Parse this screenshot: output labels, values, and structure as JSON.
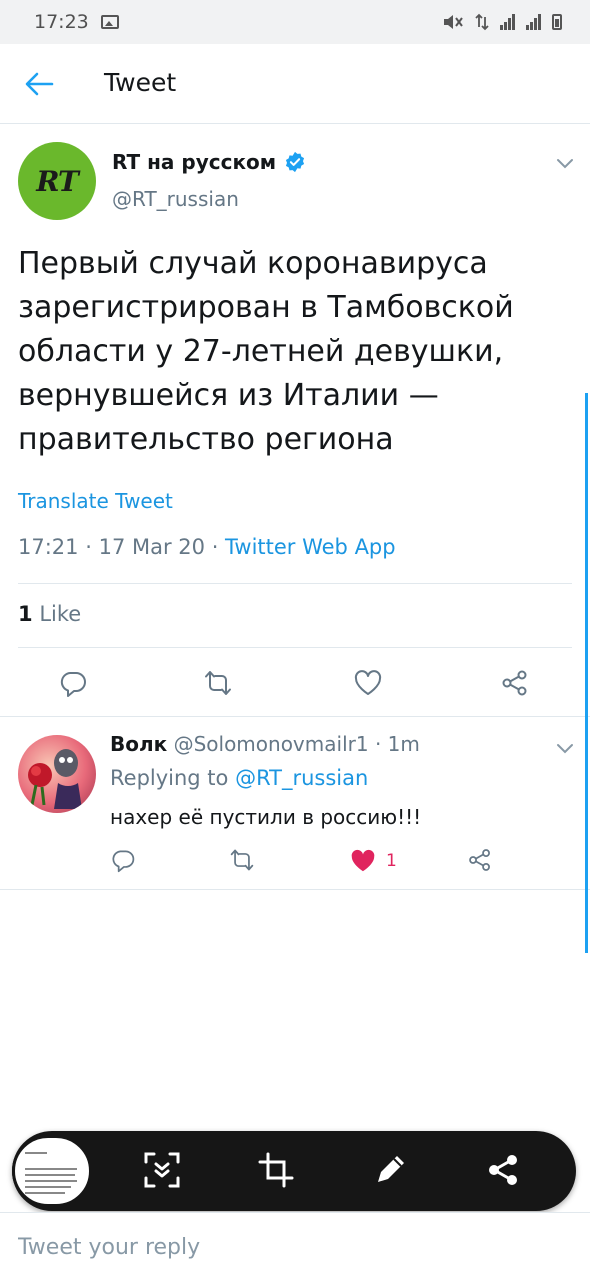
{
  "status_bar": {
    "time": "17:23"
  },
  "header": {
    "title": "Tweet"
  },
  "tweet": {
    "avatar_text": "RT",
    "author_name": "RT на русском",
    "author_handle": "@RT_russian",
    "text": "Первый случай коронавируса зарегистрирован в Тамбовской области у 27-летней девушки, вернувшейся из Италии — правительство региона",
    "translate_label": "Translate Tweet",
    "time": "17:21",
    "date": "17 Mar 20",
    "source": "Twitter Web App",
    "likes_count": "1",
    "likes_label": "Like"
  },
  "reply": {
    "author_name": "Волк",
    "author_handle": "@Solomonovmailr1",
    "time": "1m",
    "replying_to_label": "Replying to",
    "replying_to_handle": "@RT_russian",
    "text": "нахер её пустили в россию!!!",
    "like_count": "1"
  },
  "capture_toolbar": {
    "tools": [
      "scroll-capture-icon",
      "crop-icon",
      "draw-icon",
      "share-icon"
    ]
  },
  "compose": {
    "placeholder": "Tweet your reply"
  },
  "colors": {
    "accent": "#1b95e0",
    "like_red": "#e0245e",
    "rt_green": "#6ab82c",
    "secondary_text": "#657786"
  }
}
